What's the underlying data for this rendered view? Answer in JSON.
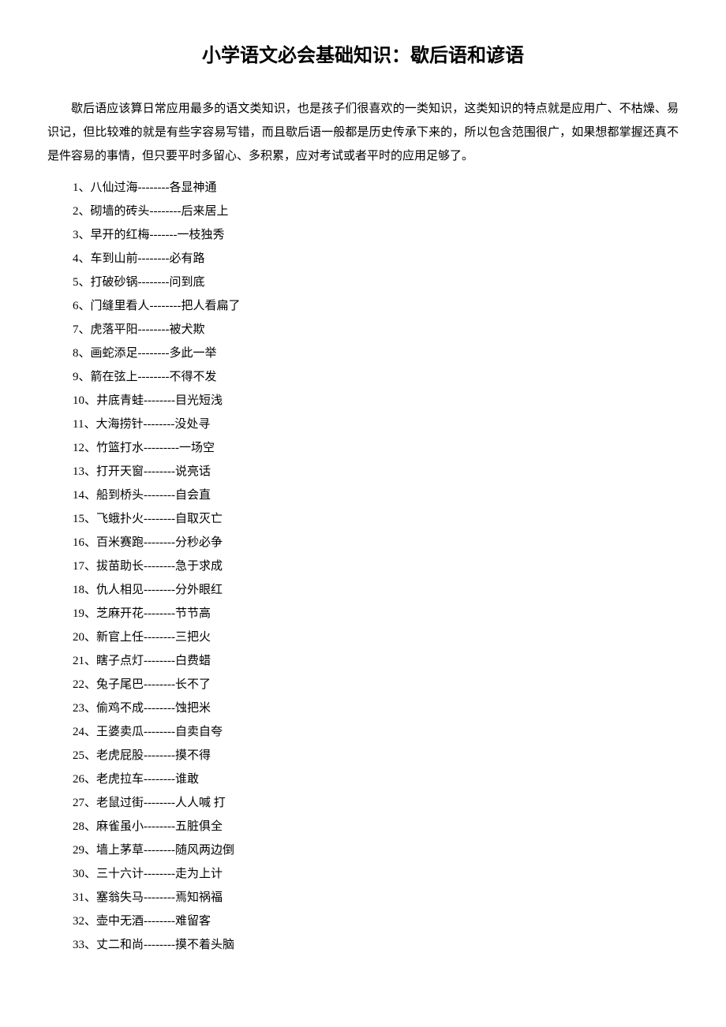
{
  "title": "小学语文必会基础知识：歇后语和谚语",
  "intro": "歇后语应该算日常应用最多的语文类知识，也是孩子们很喜欢的一类知识，这类知识的特点就是应用广、不枯燥、易识记，但比较难的就是有些字容易写错，而且歇后语一般都是历史传承下来的，所以包含范围很广，如果想都掌握还真不是件容易的事情，但只要平时多留心、多积累，应对考试或者平时的应用足够了。",
  "items": [
    "1、八仙过海--------各显神通",
    "2、砌墙的砖头--------后来居上",
    "3、早开的红梅-------一枝独秀",
    "4、车到山前--------必有路",
    "5、打破砂锅--------问到底",
    "6、门缝里看人--------把人看扁了",
    "7、虎落平阳--------被犬欺",
    "8、画蛇添足--------多此一举",
    "9、箭在弦上--------不得不发",
    "10、井底青蛙--------目光短浅",
    "11、大海捞针--------没处寻",
    "12、竹篮打水---------一场空",
    "13、打开天窗--------说亮话",
    "14、船到桥头--------自会直",
    "15、飞蛾扑火--------自取灭亡",
    "16、百米赛跑--------分秒必争",
    "17、拔苗助长--------急于求成",
    "18、仇人相见--------分外眼红",
    "19、芝麻开花--------节节高",
    "20、新官上任--------三把火",
    "21、瞎子点灯--------白费蜡",
    "22、兔子尾巴--------长不了",
    "23、偷鸡不成--------蚀把米",
    "24、王婆卖瓜--------自卖自夸",
    "25、老虎屁股--------摸不得",
    "26、老虎拉车--------谁敢",
    "27、老鼠过街--------人人喊 打",
    "28、麻雀虽小--------五脏俱全",
    "29、墙上茅草--------随风两边倒",
    "30、三十六计--------走为上计",
    "31、塞翁失马--------焉知祸福",
    "32、壶中无酒--------难留客",
    "33、丈二和尚--------摸不着头脑"
  ]
}
